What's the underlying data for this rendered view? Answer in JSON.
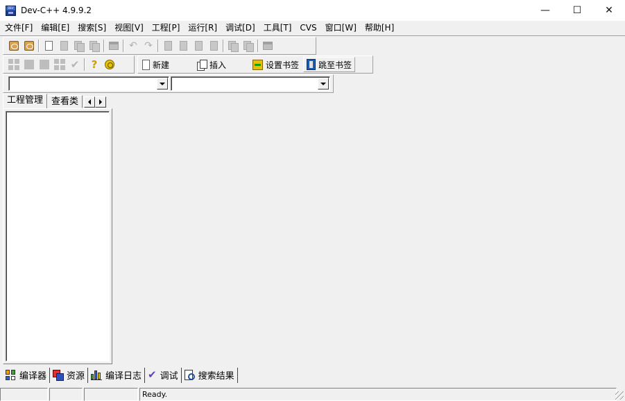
{
  "window": {
    "title": "Dev-C++ 4.9.9.2",
    "controls": {
      "minimize": "—",
      "maximize": "☐",
      "close": "✕"
    }
  },
  "menu": {
    "items": [
      "文件[F]",
      "编辑[E]",
      "搜索[S]",
      "视图[V]",
      "工程[P]",
      "运行[R]",
      "调试[D]",
      "工具[T]",
      "CVS",
      "窗口[W]",
      "帮助[H]"
    ]
  },
  "toolbar": {
    "new_label": "新建",
    "insert_label": "插入",
    "set_bookmark_label": "设置书签",
    "goto_bookmark_label": "跳至书签",
    "help_glyph": "?",
    "undo_glyph": "↶",
    "redo_glyph": "↷",
    "check_glyph": "✔"
  },
  "combos": {
    "class_value": "",
    "function_value": ""
  },
  "left_panel": {
    "tabs": [
      "工程管理",
      "查看类"
    ]
  },
  "bottom_tabs": {
    "items": [
      "编译器",
      "资源",
      "编译日志",
      "调试",
      "搜索结果"
    ],
    "debug_glyph": "✔"
  },
  "status": {
    "cell1": "",
    "cell2": "",
    "cell3": "",
    "message": "Ready."
  }
}
